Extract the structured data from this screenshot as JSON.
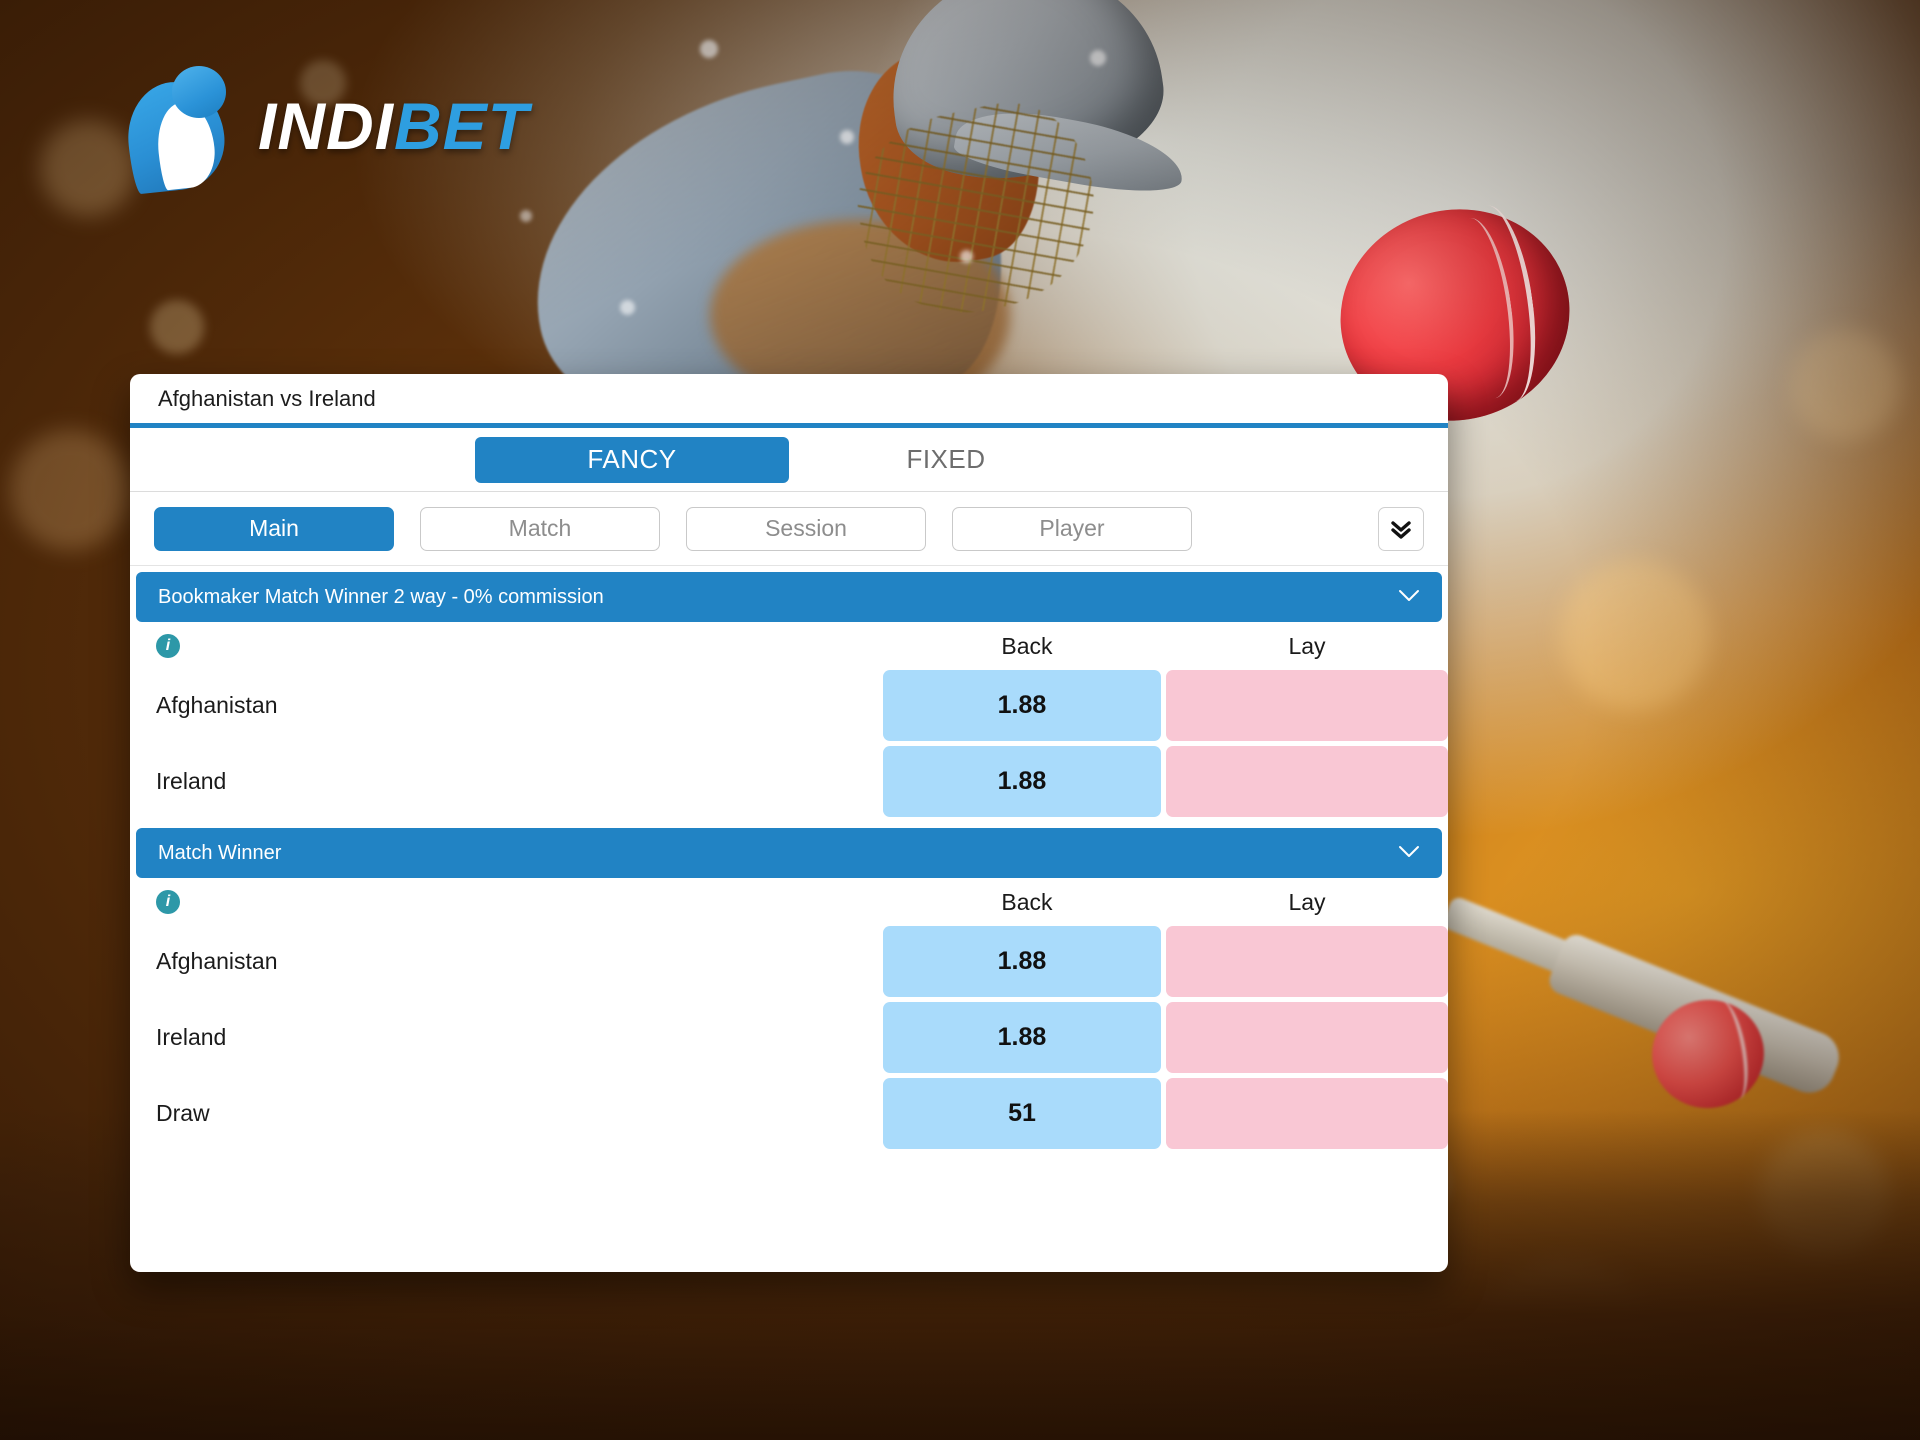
{
  "brand": {
    "name_part1": "INDI",
    "name_part2": "BET"
  },
  "card": {
    "title": "Afghanistan vs Ireland",
    "tabs": [
      {
        "label": "FANCY",
        "active": true
      },
      {
        "label": "FIXED",
        "active": false
      }
    ],
    "chips": [
      {
        "label": "Main",
        "active": true
      },
      {
        "label": "Match",
        "active": false
      },
      {
        "label": "Session",
        "active": false
      },
      {
        "label": "Player",
        "active": false
      }
    ],
    "expand_icon": "double-chevron-down-icon",
    "sections": [
      {
        "title": "Bookmaker Match Winner 2 way - 0% commission",
        "collapse_icon": "chevron-down-icon",
        "info_icon": "info-icon",
        "columns": {
          "back": "Back",
          "lay": "Lay"
        },
        "rows": [
          {
            "runner": "Afghanistan",
            "back": "1.88",
            "lay": ""
          },
          {
            "runner": "Ireland",
            "back": "1.88",
            "lay": ""
          }
        ]
      },
      {
        "title": "Match Winner",
        "collapse_icon": "chevron-down-icon",
        "info_icon": "info-icon",
        "columns": {
          "back": "Back",
          "lay": "Lay"
        },
        "rows": [
          {
            "runner": "Afghanistan",
            "back": "1.88",
            "lay": ""
          },
          {
            "runner": "Ireland",
            "back": "1.88",
            "lay": ""
          },
          {
            "runner": "Draw",
            "back": "51",
            "lay": ""
          }
        ]
      }
    ]
  },
  "colors": {
    "accent_blue": "#2183c4",
    "back_blue": "#a9dbfb",
    "lay_pink": "#f9c7d4",
    "info_teal": "#2d98a8",
    "logo_blue": "#2e9ee0"
  }
}
